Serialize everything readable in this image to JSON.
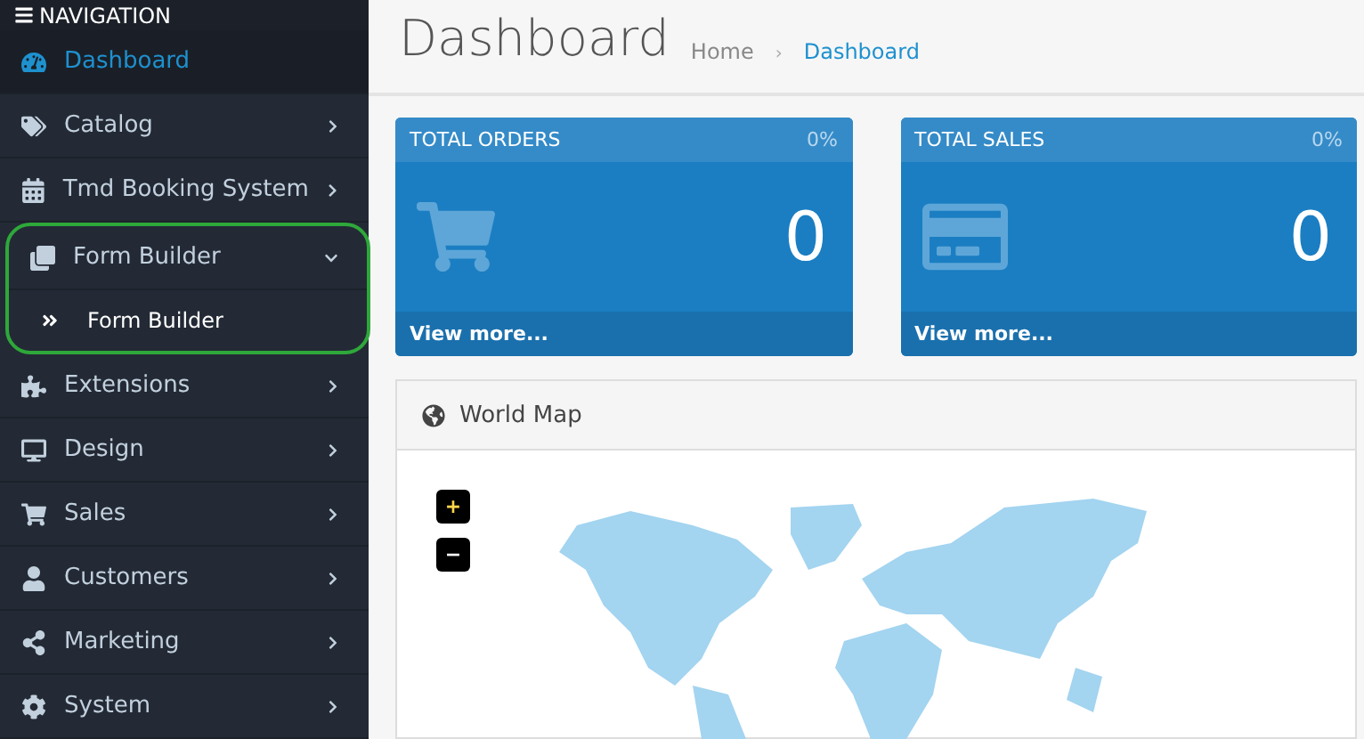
{
  "sidebar": {
    "title": "NAVIGATION",
    "items": [
      {
        "label": "Dashboard",
        "selected": true,
        "has_arrow": false
      },
      {
        "label": "Catalog",
        "selected": false,
        "has_arrow": true
      },
      {
        "label": "Tmd Booking System",
        "selected": false,
        "has_arrow": true
      },
      {
        "label": "Form Builder",
        "selected": false,
        "has_arrow": true,
        "expanded": true,
        "highlighted": true,
        "children": [
          {
            "label": "Form Builder"
          }
        ]
      },
      {
        "label": "Extensions",
        "selected": false,
        "has_arrow": true
      },
      {
        "label": "Design",
        "selected": false,
        "has_arrow": true
      },
      {
        "label": "Sales",
        "selected": false,
        "has_arrow": true
      },
      {
        "label": "Customers",
        "selected": false,
        "has_arrow": true
      },
      {
        "label": "Marketing",
        "selected": false,
        "has_arrow": true
      },
      {
        "label": "System",
        "selected": false,
        "has_arrow": true
      }
    ]
  },
  "page": {
    "title": "Dashboard",
    "breadcrumb_separator": "›",
    "breadcrumb": [
      {
        "label": "Home",
        "selected": false
      },
      {
        "label": "Dashboard",
        "selected": true
      }
    ]
  },
  "tiles": [
    {
      "kind": "orders",
      "title": "TOTAL ORDERS",
      "percent": "0%",
      "value": "0",
      "link": "View more..."
    },
    {
      "kind": "sales",
      "title": "TOTAL SALES",
      "percent": "0%",
      "value": "0",
      "link": "View more..."
    }
  ],
  "map_panel": {
    "title": "World Map",
    "zoom_in": "+",
    "zoom_out": "−"
  }
}
